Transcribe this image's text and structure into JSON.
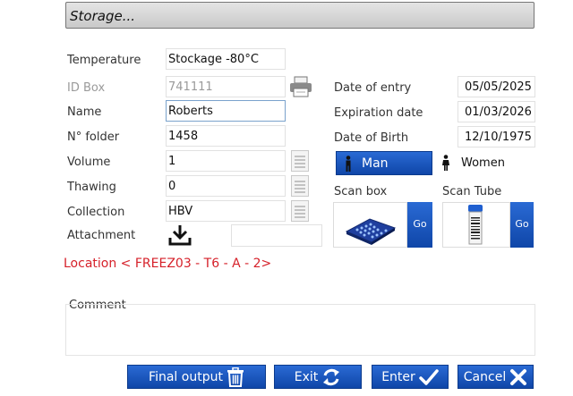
{
  "title": "Storage...",
  "fields": {
    "temperature": {
      "label": "Temperature",
      "value": "Stockage -80°C"
    },
    "id_box": {
      "label": "ID Box",
      "value": "741111"
    },
    "name": {
      "label": "Name",
      "value": "Roberts"
    },
    "folder": {
      "label": "N° folder",
      "value": "1458"
    },
    "volume": {
      "label": "Volume",
      "value": "1"
    },
    "thawing": {
      "label": "Thawing",
      "value": "0"
    },
    "collection": {
      "label": "Collection",
      "value": "HBV"
    },
    "attachment": {
      "label": "Attachment"
    }
  },
  "dates": {
    "entry": {
      "label": "Date of entry",
      "value": "05/05/2025"
    },
    "expiration": {
      "label": "Expiration date",
      "value": "01/03/2026"
    },
    "birth": {
      "label": "Date of Birth",
      "value": "12/10/1975"
    }
  },
  "gender": {
    "man": "Man",
    "women": "Women",
    "selected": "Man"
  },
  "scan": {
    "box_label": "Scan box",
    "tube_label": "Scan Tube",
    "go": "Go"
  },
  "location": "Location < FREEZ03 - T6 - A - 2>",
  "comment_label": "Comment",
  "buttons": {
    "final_output": "Final output",
    "exit": "Exit",
    "enter": "Enter",
    "cancel": "Cancel"
  },
  "colors": {
    "accent": "#1554c0",
    "location": "#d6212a"
  }
}
